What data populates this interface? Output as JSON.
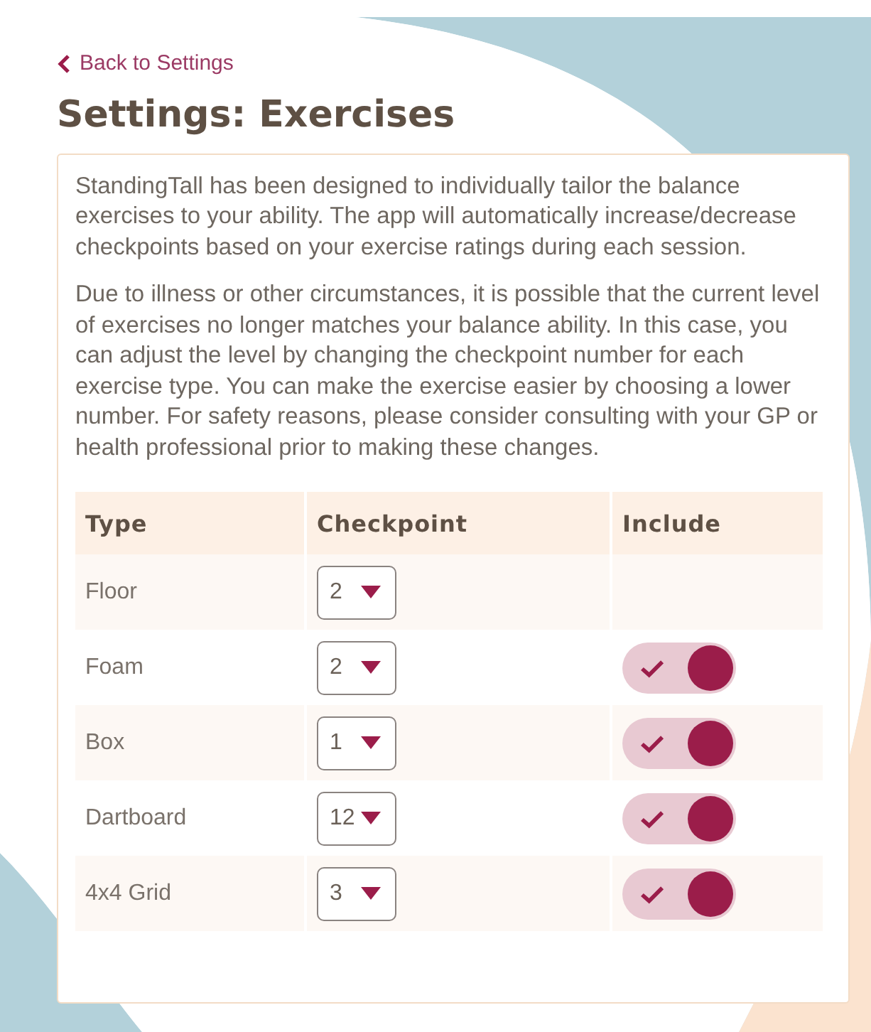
{
  "back_link": {
    "label": "Back to Settings"
  },
  "title": "Settings: Exercises",
  "paragraphs": [
    "StandingTall has been designed to individually tailor the balance exercises to your ability. The app will automatically increase/decrease checkpoints based on your exercise ratings during each session.",
    "Due to illness or other circumstances, it is possible that the current level of exercises no longer matches your balance ability. In this case, you can adjust the level by changing the checkpoint number for each exercise type. You can make the exercise easier by choosing a lower number. For safety reasons, please consider consulting with your GP or health professional prior to making these changes."
  ],
  "table": {
    "columns": [
      "Type",
      "Checkpoint",
      "Include"
    ],
    "rows": [
      {
        "type": "Floor",
        "checkpoint": "2"
      },
      {
        "type": "Foam",
        "checkpoint": "2",
        "include": true
      },
      {
        "type": "Box",
        "checkpoint": "1",
        "include": true
      },
      {
        "type": "Dartboard",
        "checkpoint": "12",
        "include": true
      },
      {
        "type": "4x4 Grid",
        "checkpoint": "3",
        "include": true
      }
    ]
  }
}
